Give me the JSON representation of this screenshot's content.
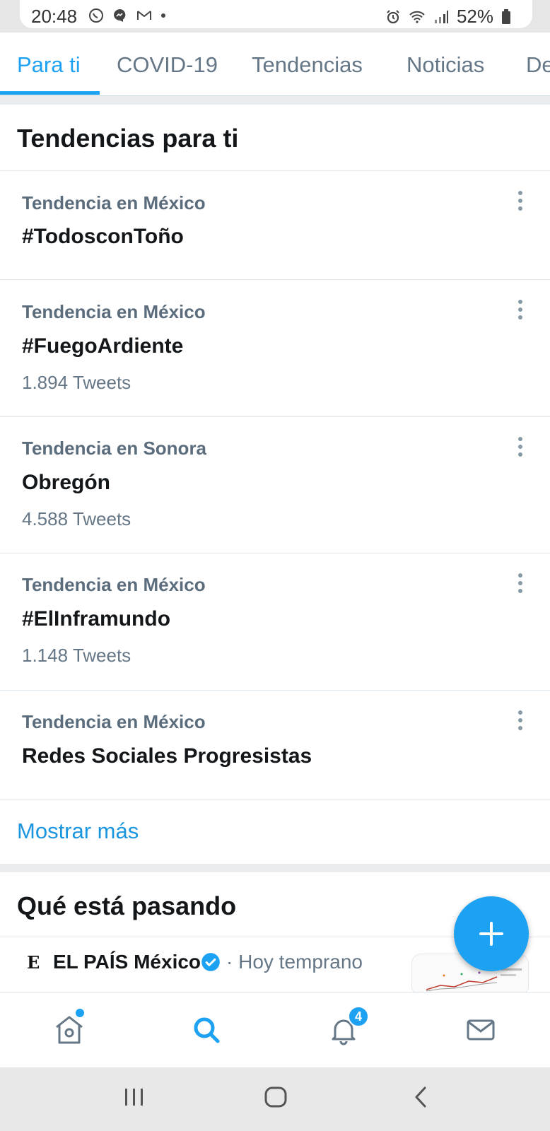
{
  "status_bar": {
    "time": "20:48",
    "battery": "52%",
    "icons_left": [
      "whatsapp-icon",
      "messenger-icon",
      "gmail-icon",
      "dot-icon"
    ],
    "icons_right": [
      "alarm-icon",
      "wifi-icon",
      "signal-icon",
      "battery-icon"
    ]
  },
  "tabs": [
    {
      "label": "Para ti",
      "active": true
    },
    {
      "label": "COVID-19",
      "active": false
    },
    {
      "label": "Tendencias",
      "active": false
    },
    {
      "label": "Noticias",
      "active": false
    },
    {
      "label": "De",
      "active": false
    }
  ],
  "trends_section": {
    "title": "Tendencias para ti",
    "items": [
      {
        "context": "Tendencia en México",
        "name": "#TodosconToño",
        "count": ""
      },
      {
        "context": "Tendencia en México",
        "name": "#FuegoArdiente",
        "count": "1.894 Tweets"
      },
      {
        "context": "Tendencia en Sonora",
        "name": "Obregón",
        "count": "4.588 Tweets"
      },
      {
        "context": "Tendencia en México",
        "name": "#ElInframundo",
        "count": "1.148 Tweets"
      },
      {
        "context": "Tendencia en México",
        "name": "Redes Sociales Progresistas",
        "count": ""
      }
    ],
    "show_more": "Mostrar más"
  },
  "happening_section": {
    "title": "Qué está pasando",
    "tweet": {
      "logo": "E",
      "author": "EL PAÍS México",
      "time": "· Hoy temprano"
    }
  },
  "bottom_nav": {
    "items": [
      "home-icon",
      "search-icon",
      "notifications-icon",
      "messages-icon"
    ],
    "notification_badge": "4"
  },
  "colors": {
    "accent": "#1da1f2",
    "text_primary": "#14171a",
    "text_secondary": "#657786"
  }
}
